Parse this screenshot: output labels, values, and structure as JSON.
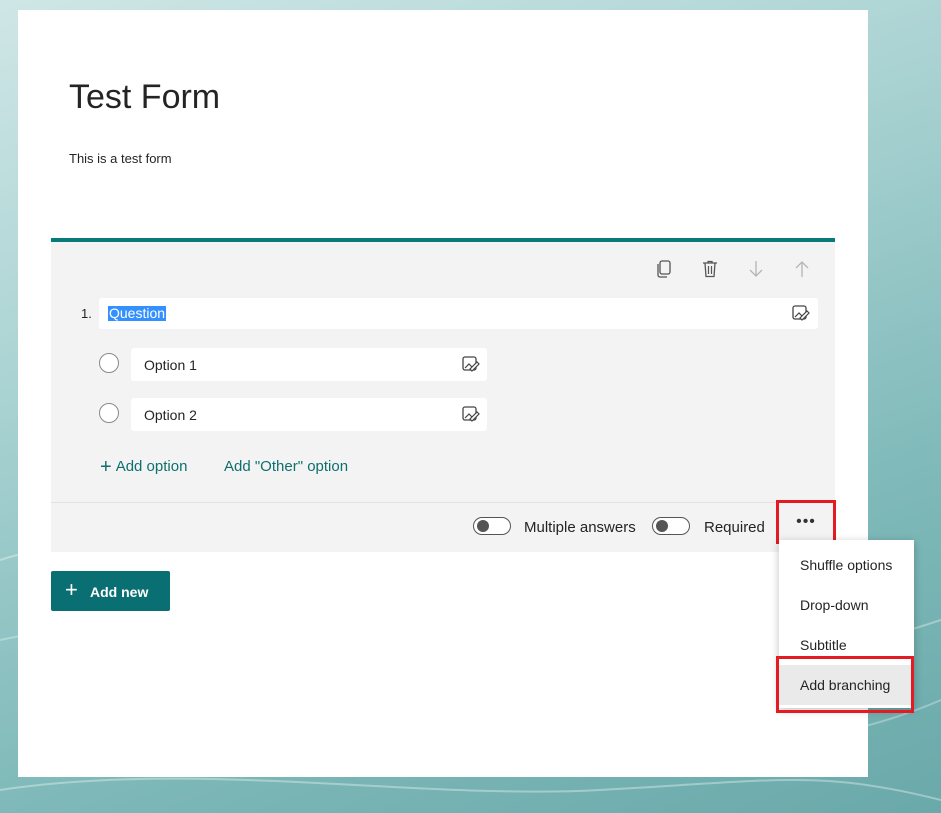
{
  "form": {
    "title": "Test Form",
    "description": "This is a test form"
  },
  "question": {
    "number": "1.",
    "text": "Question",
    "options": [
      {
        "label": "Option 1"
      },
      {
        "label": "Option 2"
      }
    ],
    "add_option_label": "Add option",
    "add_other_label": "Add \"Other\" option",
    "multiple_answers_label": "Multiple answers",
    "required_label": "Required",
    "multiple_answers_on": false,
    "required_on": false,
    "more_label": "•••"
  },
  "toolbar_icons": [
    "copy-icon",
    "delete-icon",
    "move-down-icon",
    "move-up-icon"
  ],
  "menu": {
    "items": [
      {
        "label": "Shuffle options"
      },
      {
        "label": "Drop-down"
      },
      {
        "label": "Subtitle"
      },
      {
        "label": "Add branching"
      }
    ]
  },
  "add_new_label": "Add new",
  "colors": {
    "accent": "#077a7a",
    "link": "#0f6f6f",
    "highlight_box": "#e31c23",
    "selection": "#3390ff"
  }
}
